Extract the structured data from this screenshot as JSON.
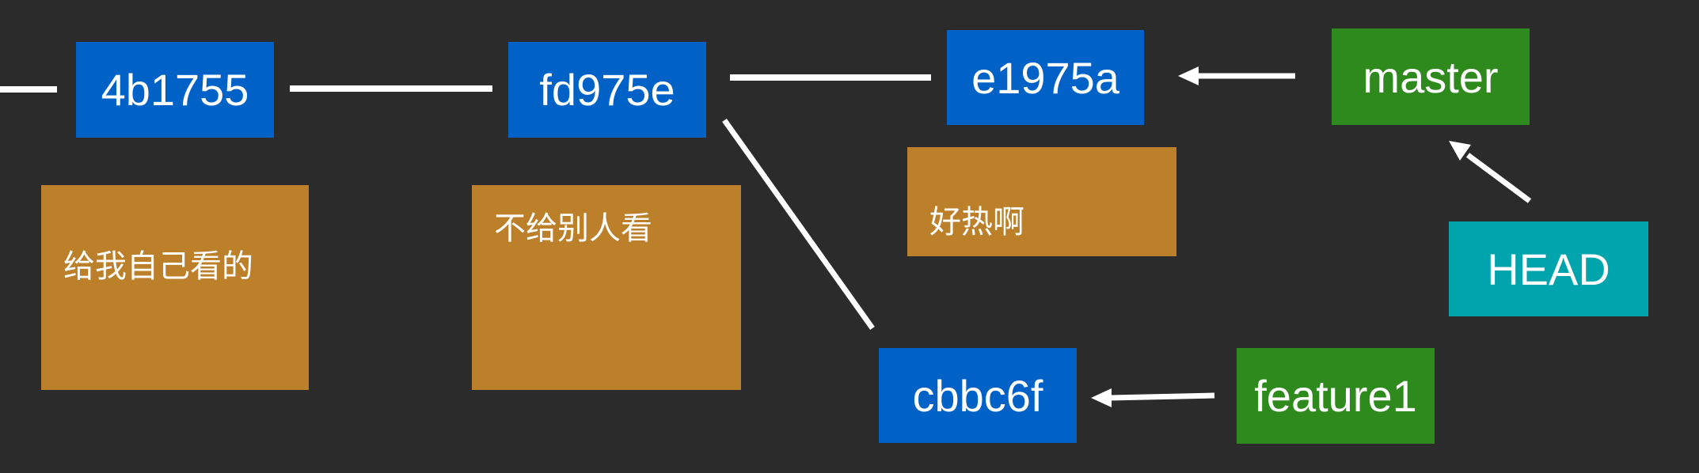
{
  "colors": {
    "background": "#2b2b2b",
    "commit": "#0062c6",
    "branch": "#2f8a1e",
    "head": "#00a4ad",
    "note": "#bd802a",
    "text": "#ffffff",
    "line": "#ffffff"
  },
  "commits": [
    {
      "id": "4b1755"
    },
    {
      "id": "fd975e"
    },
    {
      "id": "e1975a"
    },
    {
      "id": "cbbc6f"
    }
  ],
  "branches": [
    {
      "name": "master"
    },
    {
      "name": "feature1"
    }
  ],
  "head": {
    "label": "HEAD"
  },
  "notes": [
    {
      "text": "给我自己看的"
    },
    {
      "text": "不给别人看"
    },
    {
      "text": "好热啊"
    }
  ]
}
